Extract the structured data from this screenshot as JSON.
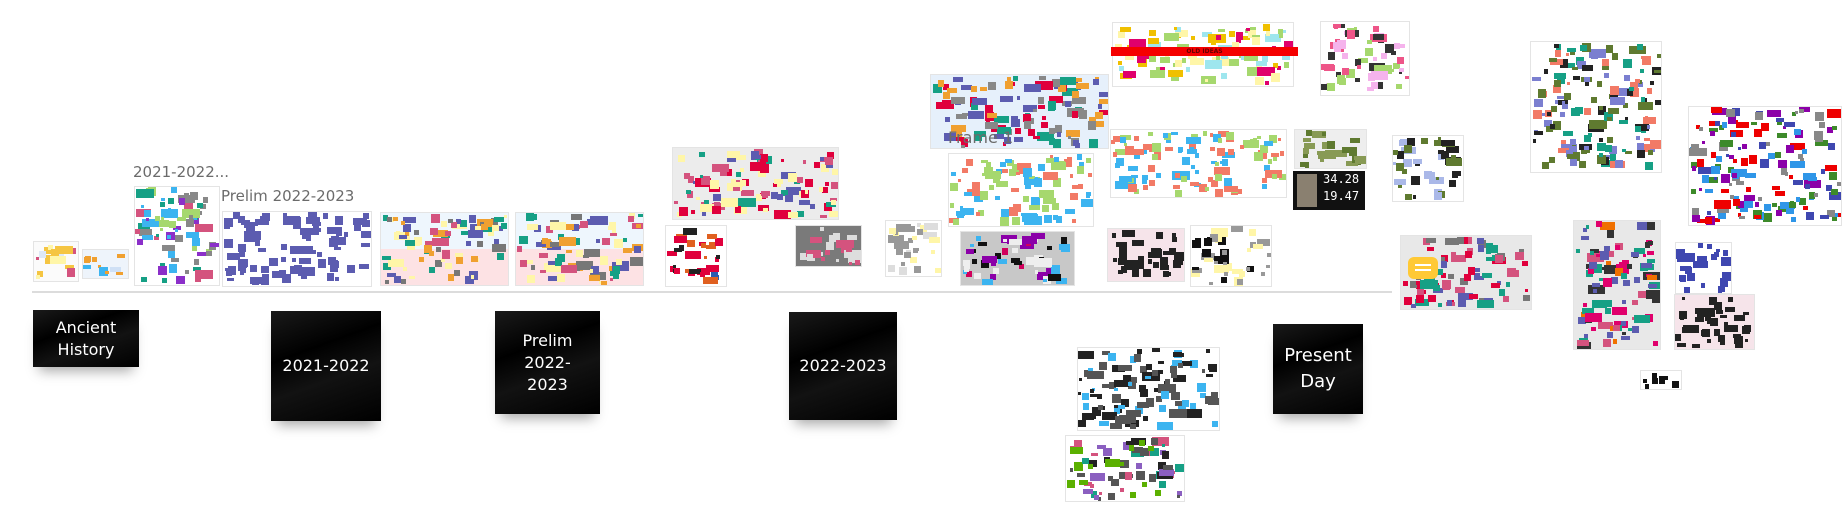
{
  "canvas": {
    "timeline_stickies": [
      {
        "label": "Ancient History"
      },
      {
        "label": "2021-2022"
      },
      {
        "label": "Prelim 2022-2023"
      },
      {
        "label": "2022-2023"
      },
      {
        "label": "Present Day"
      }
    ],
    "frame_labels": {
      "frame_2021": "2021-2022...",
      "frame_prelim": "Prelim 2022-2023",
      "frame_1": "Frame 1"
    },
    "banner": "OLD IDEAS",
    "telemetry": {
      "value_1": "34.28",
      "value_2": "19.47"
    },
    "colors": {
      "sticky": "#000000",
      "pink": "#d4537e",
      "indigo": "#5c5cb0",
      "red": "#e0003c",
      "teal": "#16a085",
      "salmon": "#f27a66",
      "green": "#a6d86e",
      "blue": "#3cb4f0",
      "yellow": "#fff6a8"
    }
  }
}
